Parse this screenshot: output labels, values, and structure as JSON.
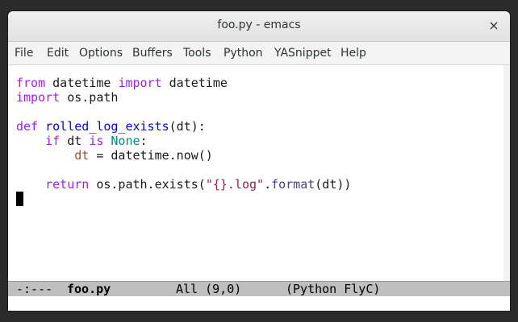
{
  "window": {
    "title": "foo.py - emacs",
    "close_glyph": "×"
  },
  "menubar": {
    "items": [
      "File",
      "Edit",
      "Options",
      "Buffers",
      "Tools",
      "Python",
      "YASnippet",
      "Help"
    ]
  },
  "code": {
    "l1": {
      "a": "from",
      "b": " datetime ",
      "c": "import",
      "d": " datetime"
    },
    "l2": {
      "a": "import",
      "b": " os.path"
    },
    "l4": {
      "a": "def",
      "b": " ",
      "c": "rolled_log_exists",
      "d": "(dt):"
    },
    "l5": {
      "indent": "    ",
      "a": "if",
      "b": " dt ",
      "c": "is",
      "d": " ",
      "e": "None",
      "f": ":"
    },
    "l6": {
      "indent": "        ",
      "a": "dt",
      "b": " = datetime.now()"
    },
    "l8": {
      "indent": "    ",
      "a": "return",
      "b": " os.path.exists(",
      "c": "\"{}.log\"",
      "d": ".",
      "e": "format",
      "f": "(dt))"
    }
  },
  "modeline": {
    "status": "-:---",
    "buffer": "foo.py",
    "position": "All (9,0)",
    "modes": "(Python FlyC)"
  },
  "colors": {
    "keyword": "#a020f0",
    "function": "#0000ff",
    "constant": "#008b8b",
    "variable": "#a0522d",
    "string": "#8b2252"
  }
}
